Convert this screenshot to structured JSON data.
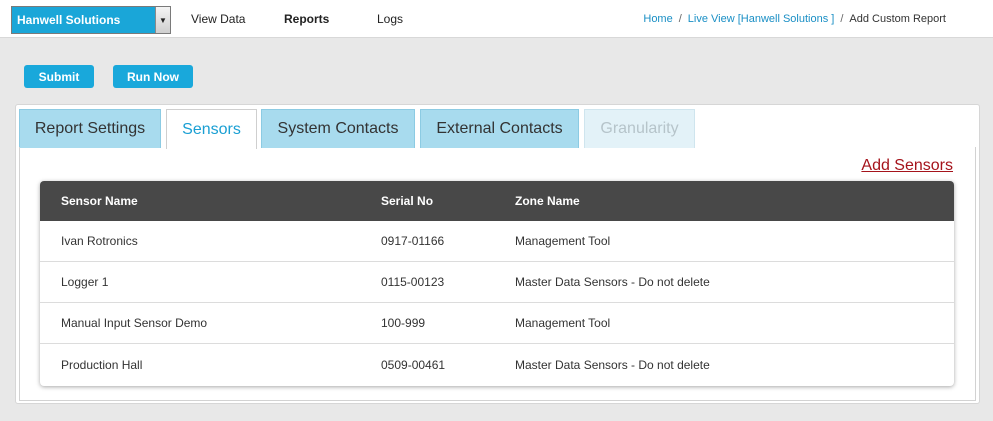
{
  "header": {
    "org_select": {
      "value": "Hanwell Solutions",
      "arrow": "▼"
    },
    "nav": [
      {
        "label": "View Data"
      },
      {
        "label": "Reports"
      },
      {
        "label": "Logs"
      }
    ],
    "breadcrumb": {
      "home": "Home",
      "live_view": "Live View [Hanwell Solutions ]",
      "current": "Add Custom Report",
      "separator": "/"
    }
  },
  "actions": {
    "submit_label": "Submit",
    "run_now_label": "Run Now"
  },
  "tabs": [
    {
      "label": "Report Settings"
    },
    {
      "label": "Sensors"
    },
    {
      "label": "System Contacts"
    },
    {
      "label": "External Contacts"
    },
    {
      "label": "Granularity"
    }
  ],
  "sensors": {
    "add_link": "Add Sensors",
    "columns": [
      "Sensor Name",
      "Serial No",
      "Zone Name"
    ],
    "rows": [
      [
        "Ivan Rotronics",
        "0917-01166",
        "Management Tool"
      ],
      [
        "Logger 1",
        "0115-00123",
        "Master Data Sensors - Do not delete"
      ],
      [
        "Manual Input Sensor Demo",
        "100-999",
        "Management Tool"
      ],
      [
        "Production Hall",
        "0509-00461",
        "Master Data Sensors - Do not delete"
      ]
    ]
  },
  "colors": {
    "accent": "#19a8db",
    "tab_inactive": "#a8dbee",
    "table_header": "#484848",
    "link_red": "#a5131b"
  }
}
